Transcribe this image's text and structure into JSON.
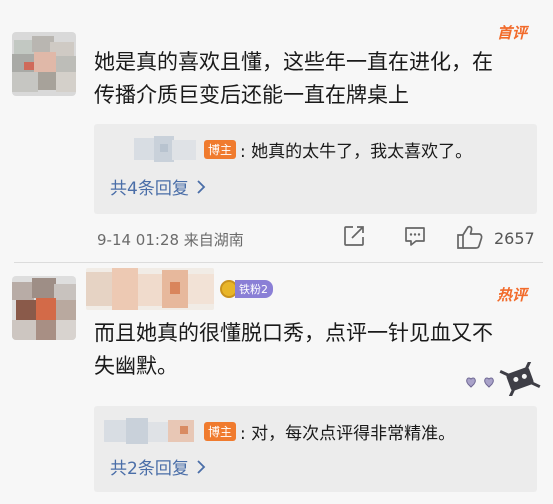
{
  "comments": [
    {
      "badge": "首评",
      "text": "她是真的喜欢且懂，这些年一直在进化，在传播介质巨变后还能一直在牌桌上",
      "reply": {
        "author_tag": "博主",
        "text": ": 她真的太牛了，我太喜欢了。"
      },
      "more_replies": "共4条回复",
      "meta": "9-14 01:28  来自湖南",
      "like_count": "2657"
    },
    {
      "badge": "热评",
      "fan_badge": "铁粉2",
      "text": "而且她真的很懂脱口秀，点评一针见血又不失幽默。",
      "reply": {
        "author_tag": "博主",
        "text": ": 对，每次点评得非常精准。"
      },
      "more_replies": "共2条回复"
    }
  ],
  "colors": {
    "accent_orange": "#f26b2b",
    "link_blue": "#4a6ea8",
    "fan_badge_purple": "#8a7fd6",
    "meta_gray": "#6b6b6b"
  }
}
